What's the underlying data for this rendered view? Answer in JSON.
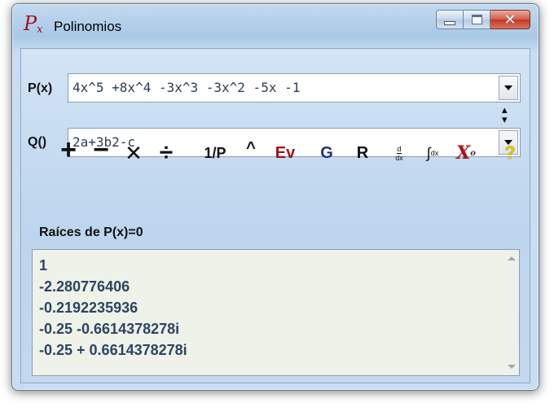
{
  "window": {
    "icon_text": "P",
    "icon_sub": "x",
    "title": "Polinomios",
    "controls": {
      "minimize": "minimize",
      "maximize": "maximize",
      "close": "✕"
    }
  },
  "p_row": {
    "label": "P(x)",
    "value": "4x^5 +8x^4 -3x^3 -3x^2 -5x -1"
  },
  "q_row": {
    "label": "Q()",
    "value": "2a+3b2-c"
  },
  "toolbar": {
    "add": "+",
    "subtract": "−",
    "multiply": "✕",
    "divide": "÷",
    "reciprocal": "1/P",
    "power": "^",
    "evaluate": "Ev",
    "g": "G",
    "r": "R",
    "derivative_num": "d",
    "derivative_den": "dx",
    "integral": "∫",
    "integral_suffix": "dx",
    "roots": "X",
    "roots_sub": "o",
    "help": "?"
  },
  "results": {
    "title": "Raíces de P(x)=0",
    "roots": [
      "1",
      "-2.280776406",
      "-0.2192235936",
      "-0.25 -0.6614378278i",
      "-0.25 + 0.6614378278i"
    ]
  },
  "colors": {
    "accent_red": "#a0121c",
    "accent_blue": "#1d2f8a",
    "root_text": "#2b4463",
    "help_yellow": "#e8c400"
  }
}
